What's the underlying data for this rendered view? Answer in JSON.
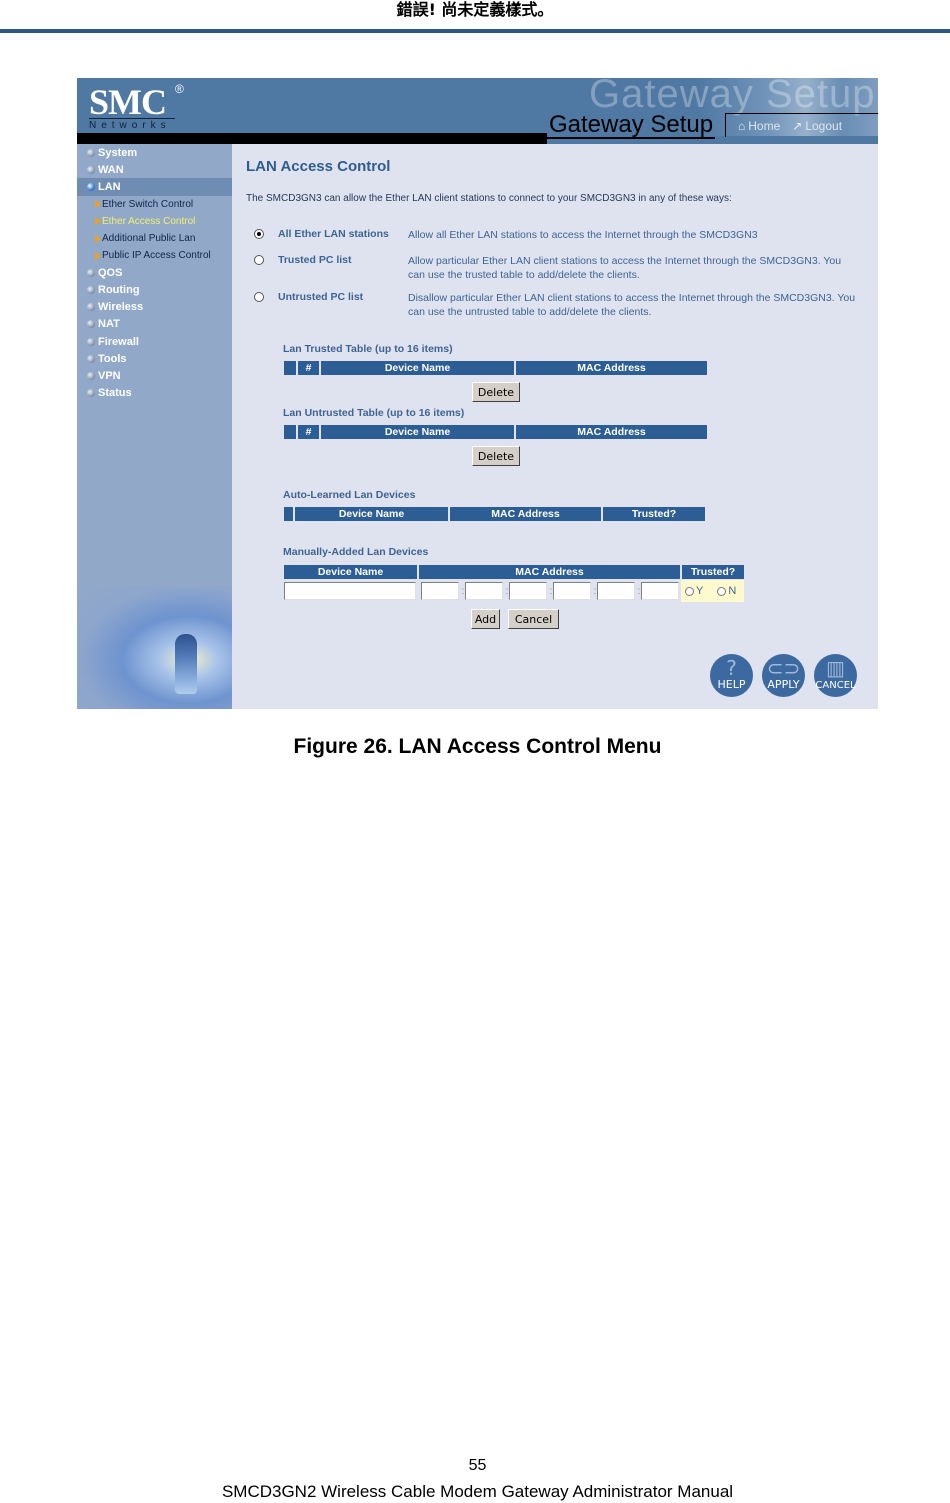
{
  "doc": {
    "header_title": "錯誤! 尚未定義樣式。",
    "caption": "Figure 26. LAN Access Control Menu",
    "page_number": "55",
    "footer": "SMCD3GN2 Wireless Cable Modem Gateway Administrator Manual",
    "rule_color": "#2b5780"
  },
  "app": {
    "logo_text": "SMC",
    "logo_reg": "®",
    "logo_sub": "Networks",
    "banner_ghost": "Gateway Setup",
    "banner_title": "Gateway Setup",
    "nav": {
      "home": {
        "label": "Home",
        "icon": "home-icon"
      },
      "logout": {
        "label": "Logout",
        "icon": "logout-icon"
      }
    },
    "colors": {
      "banner": "#4f78a3",
      "sidebar": "#91a8c9",
      "content_bg": "#dfe3ef",
      "table_header": "#2c5d95",
      "accent_text": "#3e6496",
      "active_sub": "#f4f06a"
    }
  },
  "sidebar": {
    "items": [
      {
        "label": "System"
      },
      {
        "label": "WAN"
      },
      {
        "label": "LAN",
        "active": true
      },
      {
        "label": "QOS"
      },
      {
        "label": "Routing"
      },
      {
        "label": "Wireless"
      },
      {
        "label": "NAT"
      },
      {
        "label": "Firewall"
      },
      {
        "label": "Tools"
      },
      {
        "label": "VPN"
      },
      {
        "label": "Status"
      }
    ],
    "lan_subitems": [
      {
        "label": "Ether Switch Control"
      },
      {
        "label": "Ether Access Control",
        "active": true
      },
      {
        "label": "Additional Public Lan"
      },
      {
        "label": "Public IP Access Control"
      }
    ]
  },
  "main": {
    "title": "LAN Access Control",
    "intro": "The SMCD3GN3 can allow the Ether LAN client stations to connect to your SMCD3GN3 in any of these ways:",
    "options": [
      {
        "label": "All Ether LAN stations",
        "desc": "Allow all Ether LAN stations to access the Internet through the SMCD3GN3",
        "checked": true
      },
      {
        "label": "Trusted PC list",
        "desc": "Allow particular Ether LAN client stations to access the Internet through the SMCD3GN3. You can use the trusted table to add/delete the clients.",
        "checked": false
      },
      {
        "label": "Untrusted PC list",
        "desc": "Disallow particular Ether LAN client stations to access the Internet through the SMCD3GN3. You can use the untrusted table to add/delete the clients.",
        "checked": false
      }
    ],
    "trusted_table": {
      "title": "Lan Trusted Table (up to 16 items)",
      "columns": [
        "",
        "#",
        "Device Name",
        "MAC Address"
      ],
      "rows": [],
      "delete_label": "Delete"
    },
    "untrusted_table": {
      "title": "Lan Untrusted Table (up to 16 items)",
      "columns": [
        "",
        "#",
        "Device Name",
        "MAC Address"
      ],
      "rows": [],
      "delete_label": "Delete"
    },
    "auto_learned": {
      "title": "Auto-Learned Lan Devices",
      "columns": [
        "",
        "Device Name",
        "MAC Address",
        "Trusted?"
      ],
      "rows": []
    },
    "manual": {
      "title": "Manually-Added Lan Devices",
      "columns": [
        "Device Name",
        "MAC Address",
        "Trusted?"
      ],
      "device_name_value": "",
      "mac_octets": [
        "",
        "",
        "",
        "",
        "",
        ""
      ],
      "mac_separator": ":",
      "trusted_yes": "Y",
      "trusted_no": "N",
      "add_label": "Add",
      "cancel_label": "Cancel"
    },
    "action_buttons": {
      "help": "HELP",
      "apply": "APPLY",
      "cancel": "CANCEL"
    }
  }
}
